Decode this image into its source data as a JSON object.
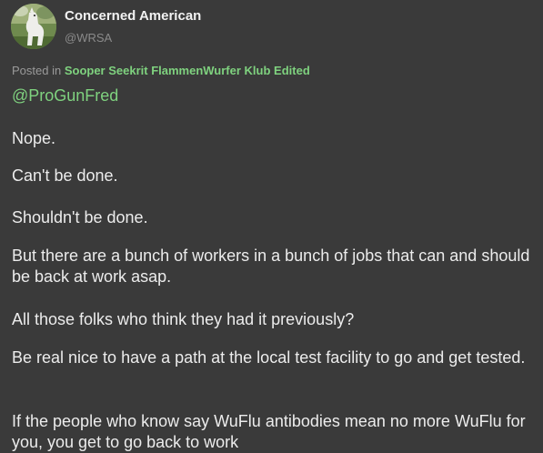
{
  "author": {
    "name": "Concerned American",
    "handle": "@WRSA"
  },
  "meta": {
    "prefix": "Posted in",
    "group": "Sooper Seekrit FlammenWurfer Klub",
    "edited": "Edited"
  },
  "mention": "@ProGunFred",
  "paragraphs": [
    "Nope.",
    "Can't be done.",
    "Shouldn't be done.",
    "But there are a bunch of workers in a bunch of jobs that can and should be back at work asap.",
    "All those folks who think they had it previously?",
    "Be real nice to have a path at the local test facility to go and get tested.",
    "If the people who know say WuFlu antibodies mean no more WuFlu for you, you get to go back to work"
  ],
  "colors": {
    "background": "#3a3a3a",
    "link_green": "#7fd27f",
    "text": "#ececec",
    "muted": "#8a8a8a"
  }
}
